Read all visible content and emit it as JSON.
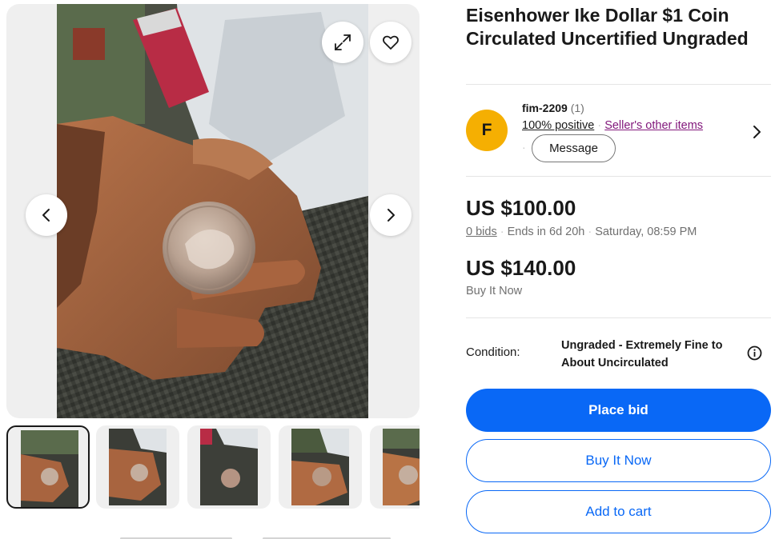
{
  "listing": {
    "title": "Eisenhower Ike Dollar $1 Coin Circulated Uncertified Ungraded"
  },
  "gallery": {
    "main_image_alt": "Eisenhower dollar coin held in hand",
    "thumbnail_count": 5,
    "selected_thumbnail": 1
  },
  "seller": {
    "initial": "F",
    "name": "fim-2209",
    "feedback_count": "(1)",
    "positive": "100% positive",
    "separator": "·",
    "other_items": "Seller's other items",
    "message_button": "Message",
    "avatar_color": "#f5af02"
  },
  "pricing": {
    "current_bid": "US $100.00",
    "bids": "0 bids",
    "separator": "·",
    "ends_in": "Ends in 6d 20h",
    "end_time": "Saturday, 08:59 PM",
    "buy_it_now_price": "US $140.00",
    "buy_it_now_label": "Buy It Now"
  },
  "condition": {
    "label": "Condition:",
    "value": "Ungraded - Extremely Fine to About Uncirculated"
  },
  "actions": {
    "place_bid": "Place bid",
    "buy_it_now": "Buy It Now",
    "add_to_cart": "Add to cart"
  },
  "colors": {
    "primary_blue": "#0968f6",
    "link_purple": "#82187c",
    "text_dark": "#191919",
    "text_muted": "#707070"
  },
  "icons": [
    "expand-icon",
    "heart-icon",
    "chevron-left-icon",
    "chevron-right-icon",
    "info-icon"
  ]
}
